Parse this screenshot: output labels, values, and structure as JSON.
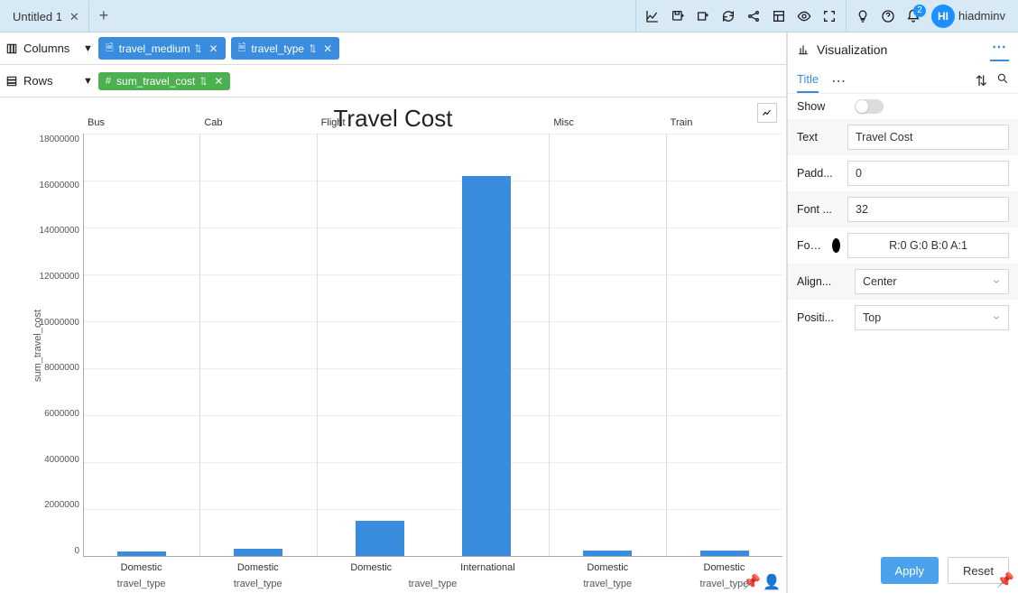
{
  "topbar": {
    "tab_title": "Untitled 1",
    "username": "hiadminv",
    "avatar_initials": "HI",
    "notification_count": "2"
  },
  "shelves": {
    "columns_label": "Columns",
    "rows_label": "Rows",
    "columns_pills": [
      {
        "name": "travel_medium"
      },
      {
        "name": "travel_type"
      }
    ],
    "rows_pills": [
      {
        "name": "sum_travel_cost"
      }
    ]
  },
  "sidepanel": {
    "header": "Visualization",
    "tab_title": "Title",
    "rows": {
      "show_label": "Show",
      "text_label": "Text",
      "text_value": "Travel Cost",
      "padding_label": "Padd...",
      "padding_value": "0",
      "fontsize_label": "Font ...",
      "fontsize_value": "32",
      "fontcolor_label": "Font ...",
      "fontcolor_value": "R:0 G:0 B:0 A:1",
      "align_label": "Align...",
      "align_value": "Center",
      "position_label": "Positi...",
      "position_value": "Top"
    },
    "apply_label": "Apply",
    "reset_label": "Reset"
  },
  "chart": {
    "title": "Travel Cost",
    "y_axis_label": "sum_travel_cost"
  },
  "chart_data": {
    "type": "bar",
    "title": "Travel Cost",
    "ylabel": "sum_travel_cost",
    "ylim": [
      0,
      18000000
    ],
    "y_ticks": [
      18000000,
      16000000,
      14000000,
      12000000,
      10000000,
      8000000,
      6000000,
      4000000,
      2000000,
      0
    ],
    "facet_field": "travel_medium",
    "x_field": "travel_type",
    "x_axis_sublabel": "travel_type",
    "panels": [
      {
        "facet": "Bus",
        "bars": [
          {
            "x": "Domestic",
            "value": 200000
          }
        ]
      },
      {
        "facet": "Cab",
        "bars": [
          {
            "x": "Domestic",
            "value": 300000
          }
        ]
      },
      {
        "facet": "Flight",
        "bars": [
          {
            "x": "Domestic",
            "value": 1500000
          },
          {
            "x": "International",
            "value": 16200000
          }
        ]
      },
      {
        "facet": "Misc",
        "bars": [
          {
            "x": "Domestic",
            "value": 250000
          }
        ]
      },
      {
        "facet": "Train",
        "bars": [
          {
            "x": "Domestic",
            "value": 250000
          }
        ]
      }
    ]
  }
}
